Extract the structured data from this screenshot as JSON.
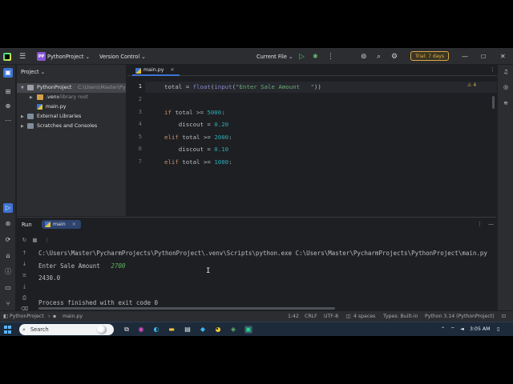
{
  "titlebar": {
    "project_badge": "PP",
    "project_name": "PythonProject",
    "vc_label": "Version Control",
    "run_config": "Current File",
    "trial_label": "Trial: 7 days"
  },
  "project_panel": {
    "header": "Project",
    "items": [
      {
        "label": "PythonProject",
        "hint": "C:\\Users\\Master\\PycharmProjects\\PythonProject"
      },
      {
        "label": ".venv",
        "hint": "library root"
      },
      {
        "label": "main.py",
        "hint": ""
      },
      {
        "label": "External Libraries",
        "hint": ""
      },
      {
        "label": "Scratches and Consoles",
        "hint": ""
      }
    ]
  },
  "editor": {
    "tab_label": "main.py",
    "warning_count": "4",
    "line_numbers": [
      "1",
      "2",
      "3",
      "4",
      "5",
      "6",
      "7"
    ],
    "lines": [
      "total = float(input(\"Enter Sale Amount   \"))",
      "",
      "if total >= 5000:",
      "    discout = 0.20",
      "elif total >= 2000:",
      "    discout = 0.10",
      "elif total >= 1000:"
    ]
  },
  "run": {
    "title": "Run",
    "tab_label": "main",
    "command": "C:\\Users\\Master\\PycharmProjects\\PythonProject\\.venv\\Scripts\\python.exe C:\\Users\\Master\\PycharmProjects\\PythonProject\\main.py",
    "prompt": "Enter Sale Amount   ",
    "input_value": "2700",
    "result": "2430.0",
    "exit_msg": "Process finished with exit code 0"
  },
  "statusbar": {
    "breadcrumb_project": "PythonProject",
    "breadcrumb_file": "main.py",
    "position": "1:42",
    "line_sep": "CRLF",
    "encoding": "UTF-8",
    "indent": "4 spaces",
    "types": "Types: Built-in",
    "interpreter": "Python 3.14 (PythonProject)"
  },
  "taskbar": {
    "search_placeholder": "Search",
    "time": "3:05 AM"
  }
}
